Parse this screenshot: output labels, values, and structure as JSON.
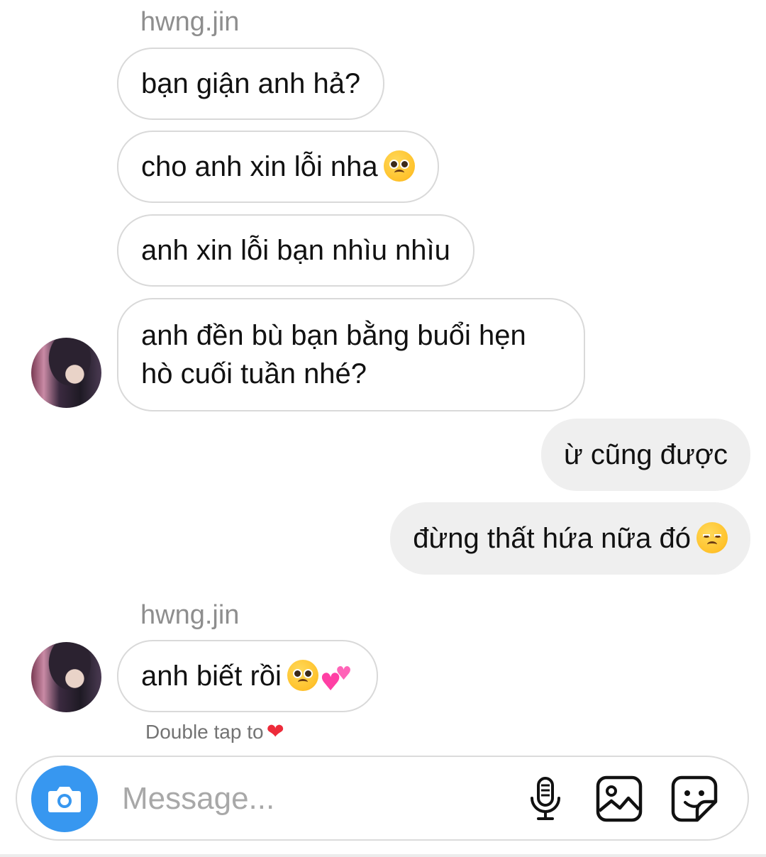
{
  "thread": {
    "other_user": "hwng.jin",
    "messages": [
      {
        "side": "in",
        "text": "bạn giận anh hả?"
      },
      {
        "side": "in",
        "text": "cho anh xin lỗi nha",
        "emoji": "pleading-face"
      },
      {
        "side": "in",
        "text": "anh xin lỗi bạn nhìu nhìu"
      },
      {
        "side": "in",
        "text_line1": "anh đền bù bạn bằng buổi hẹn",
        "text_line2": "hò cuối tuần nhé?"
      },
      {
        "side": "out",
        "text": "ừ cũng được"
      },
      {
        "side": "out",
        "text": "đừng thất hứa nữa đó",
        "emoji": "disappointed-face"
      },
      {
        "side": "in",
        "text": "anh biết rồi",
        "emoji": [
          "pleading-face",
          "two-hearts"
        ]
      }
    ],
    "double_tap_hint": "Double tap to",
    "double_tap_icon": "red-heart"
  },
  "composer": {
    "placeholder": "Message...",
    "value": "",
    "camera_icon": "camera-icon",
    "mic_icon": "microphone-icon",
    "gallery_icon": "gallery-icon",
    "sticker_icon": "sticker-icon",
    "accent_color": "#3797f0"
  },
  "colors": {
    "incoming_bubble_border": "#d9d9d9",
    "outgoing_bubble_bg": "#efefef",
    "username": "#8e8e8e"
  }
}
